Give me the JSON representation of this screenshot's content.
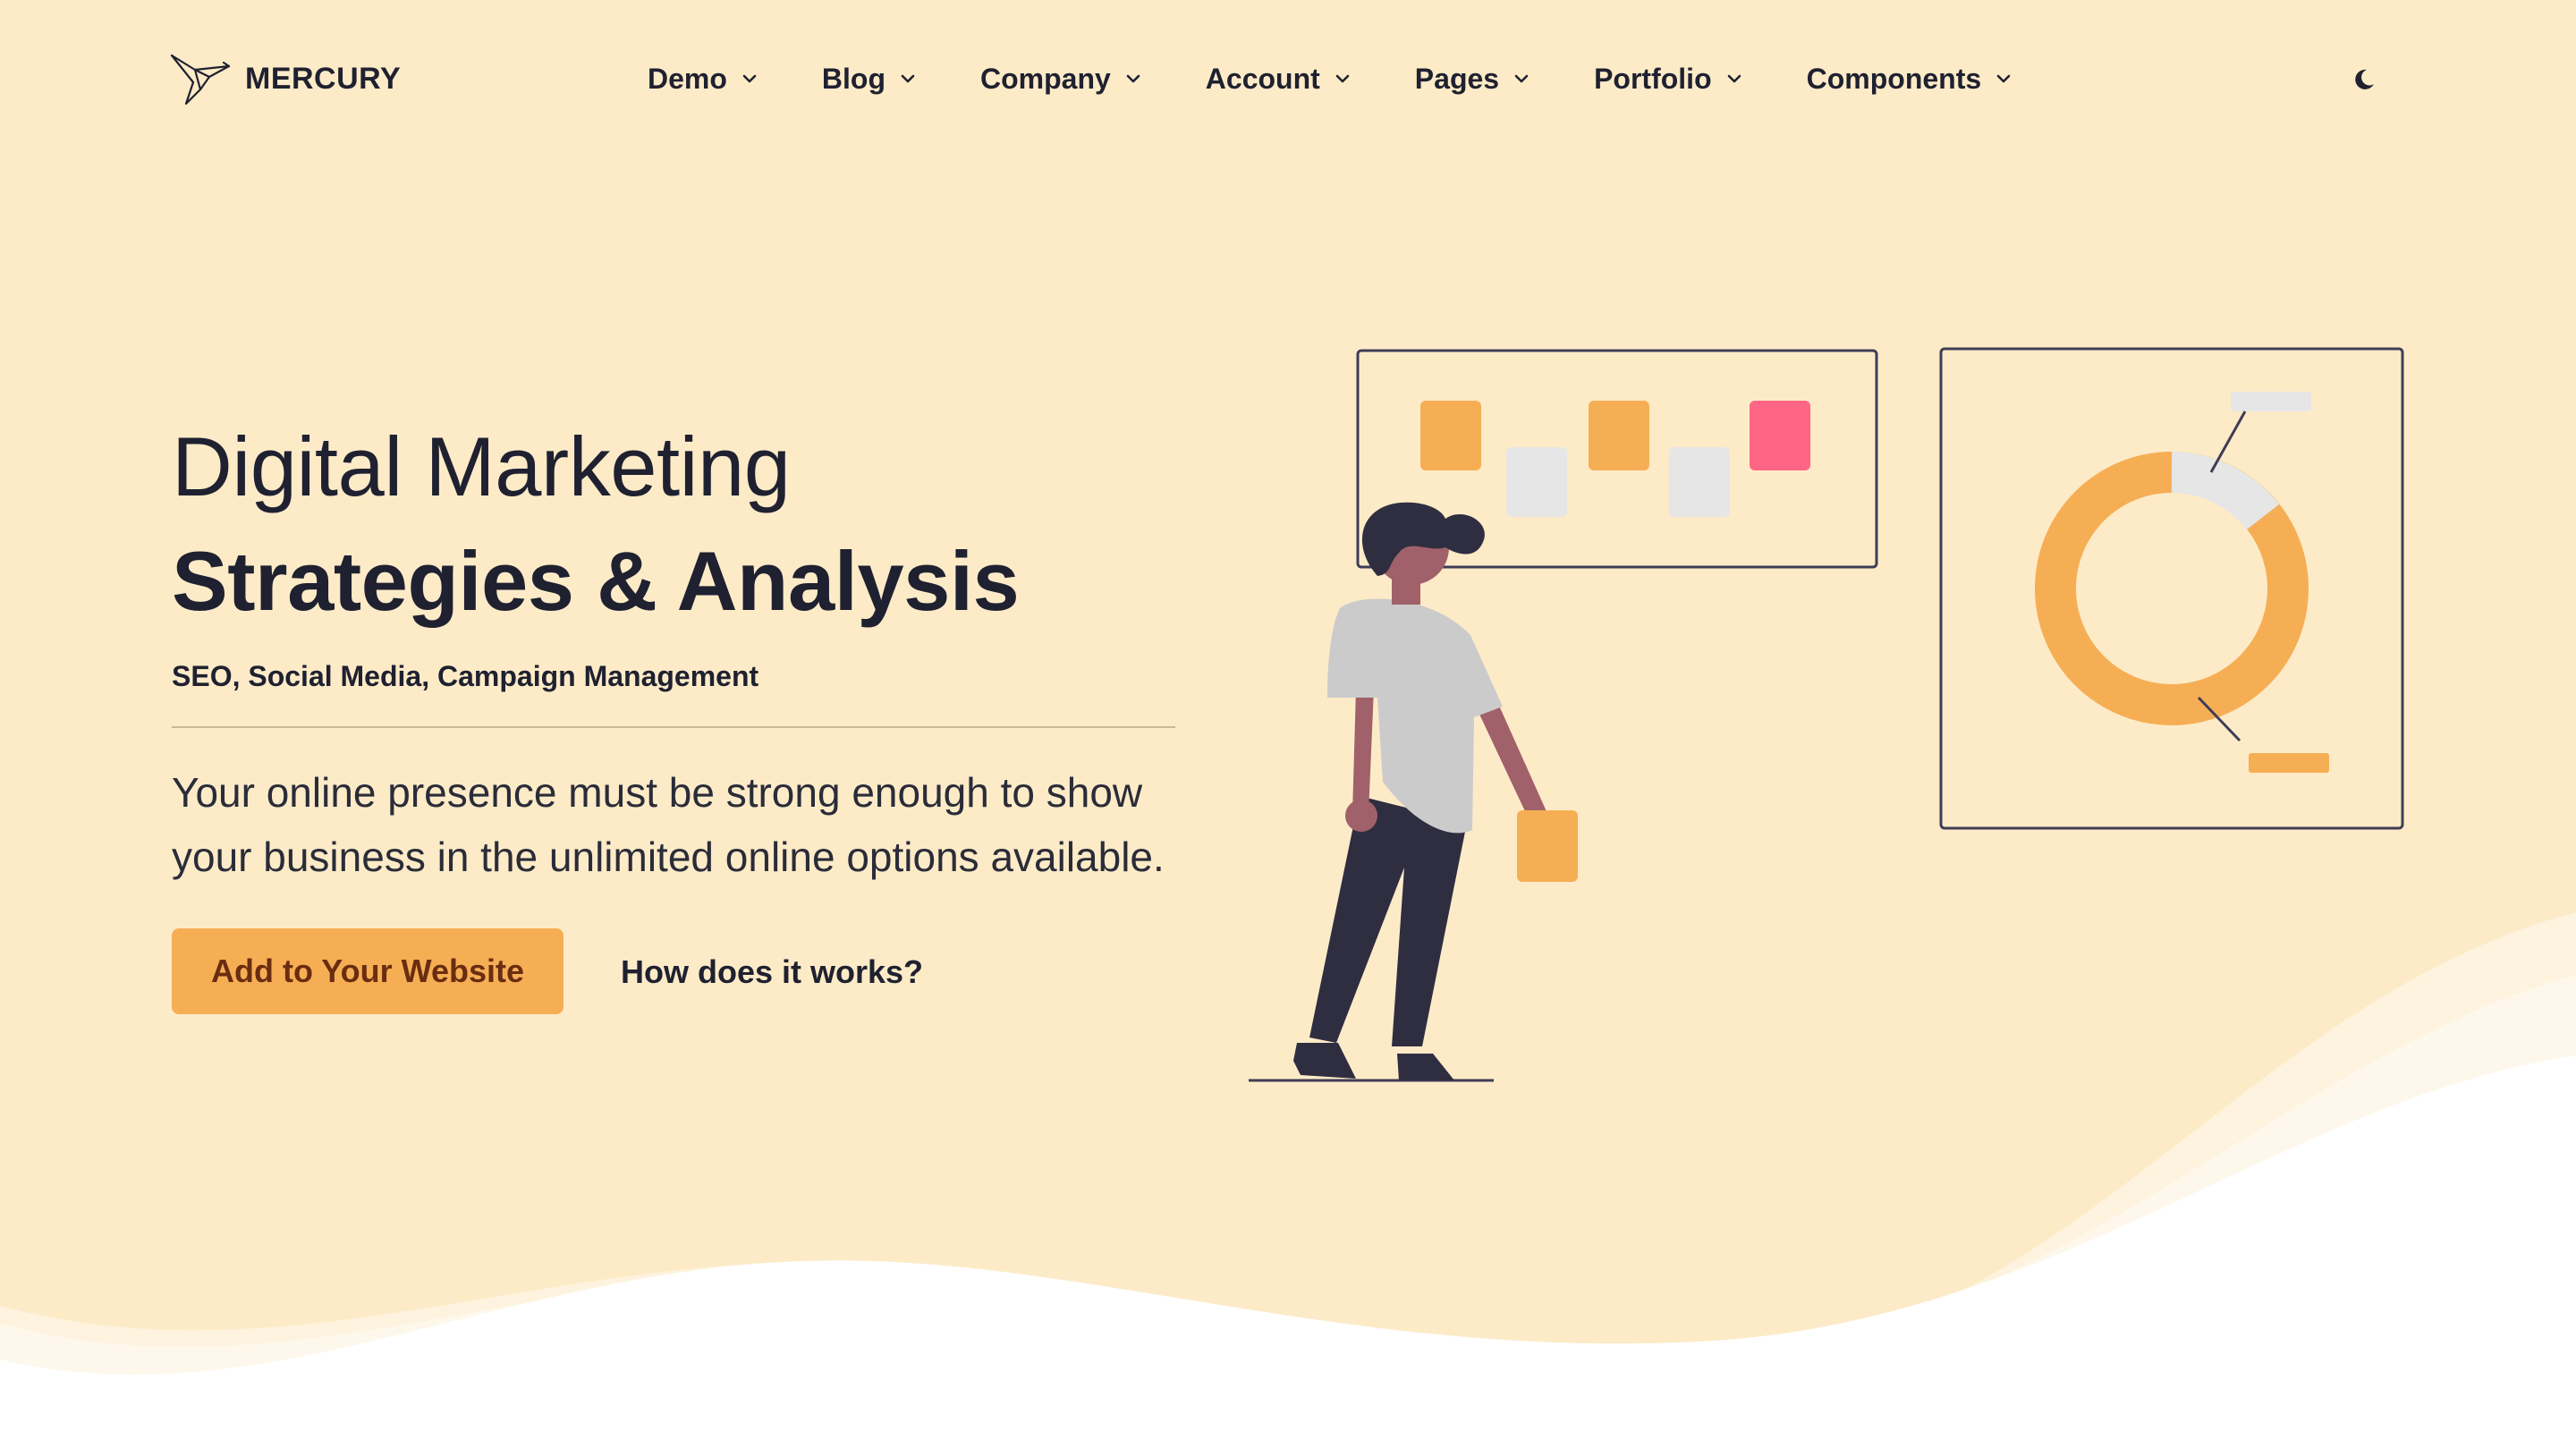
{
  "brand": {
    "name": "MERCURY",
    "logo_icon": "bird-icon"
  },
  "nav": {
    "items": [
      {
        "label": "Demo"
      },
      {
        "label": "Blog"
      },
      {
        "label": "Company"
      },
      {
        "label": "Account"
      },
      {
        "label": "Pages"
      },
      {
        "label": "Portfolio"
      },
      {
        "label": "Components"
      }
    ],
    "dropdown_icon": "chevron-down-icon",
    "theme_toggle_icon": "moon-icon"
  },
  "hero": {
    "title_light": "Digital Marketing",
    "title_bold": "Strategies & Analysis",
    "subtitle": "SEO, Social Media, Campaign Management",
    "description": "Your online presence must be strong enough to show your business in the unlimited online options available.",
    "primary_button": "Add to Your Website",
    "secondary_link": "How does it works?"
  },
  "colors": {
    "background": "#fdebc8",
    "accent": "#f6ae55",
    "accent_text": "#6a2d10",
    "pink": "#ff6584",
    "text": "#1f2130"
  }
}
